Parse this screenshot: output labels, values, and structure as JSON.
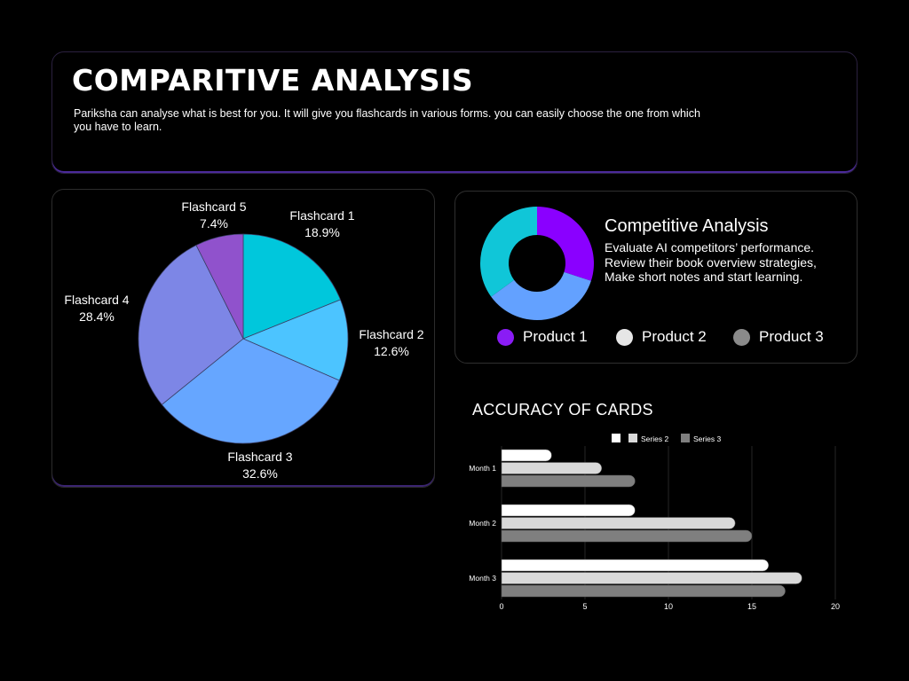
{
  "header": {
    "title": "COMPARITIVE ANALYSIS",
    "description": "Pariksha can analyse what is best for you. It will give you flashcards in various forms. you can easily choose the one from which you have to learn."
  },
  "competitive": {
    "title": "Competitive Analysis",
    "lines": [
      "Evaluate AI competitors’  performance.",
      "Review their book overview strategies,",
      "Make short notes and start learning."
    ],
    "legend": [
      {
        "label": "Product 1",
        "color": "#8a1cf5"
      },
      {
        "label": "Product 2",
        "color": "#e6e6e6"
      },
      {
        "label": "Product 3",
        "color": "#8a8a8a"
      }
    ]
  },
  "chart_data": [
    {
      "type": "pie",
      "categories": [
        "Flashcard 1",
        "Flashcard 2",
        "Flashcard 3",
        "Flashcard 4",
        "Flashcard 5"
      ],
      "values": [
        18.9,
        12.6,
        32.6,
        28.4,
        7.4
      ],
      "value_labels": [
        "18.9%",
        "12.6%",
        "32.6%",
        "28.4%",
        "7.4%"
      ],
      "colors": [
        "#00c7dc",
        "#4cc4ff",
        "#66a6ff",
        "#7d86e6",
        "#9052cc"
      ]
    },
    {
      "type": "pie",
      "variant": "donut",
      "values": [
        30,
        35,
        35
      ],
      "colors": [
        "#8a00ff",
        "#63a1ff",
        "#10c6d8"
      ]
    },
    {
      "type": "bar",
      "orientation": "horizontal",
      "title": "ACCURACY OF CARDS",
      "categories": [
        "Month 1",
        "Month 2",
        "Month 3"
      ],
      "series": [
        {
          "name": "",
          "values": [
            3,
            8,
            16
          ],
          "color": "#ffffff"
        },
        {
          "name": "Series 2",
          "values": [
            6,
            14,
            18
          ],
          "color": "#d9d9d9"
        },
        {
          "name": "Series 3",
          "values": [
            8,
            15,
            17
          ],
          "color": "#7f7f7f"
        }
      ],
      "xlim": [
        0,
        20
      ],
      "xticks": [
        "0",
        "5",
        "10",
        "15",
        "20"
      ],
      "grid": true,
      "legend": "top"
    }
  ]
}
